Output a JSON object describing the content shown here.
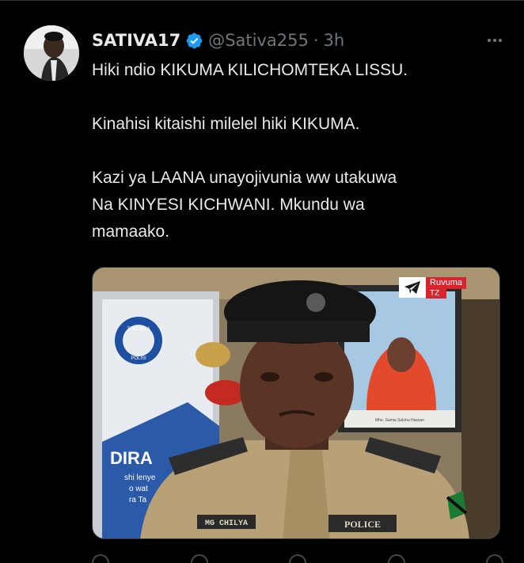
{
  "tweet": {
    "display_name": "SATIVA17",
    "verified": true,
    "handle": "@Sativa255",
    "separator": "·",
    "time": "3h",
    "lines": [
      "Hiki ndio KIKUMA KILICHOMTEKA LISSU.",
      "Kinahisi kitaishi milelel hiki KIKUMA.",
      "Kazi ya LAANA unayojivunia  ww utakuwa",
      "Na KINYESI KICHWANI. Mkundu wa",
      "mamaako."
    ]
  },
  "media": {
    "watermark_line1": "Ruvuma",
    "watermark_line2": "TZ",
    "sign_word": "DIRA",
    "sign_small": [
      "shi lenye",
      "o wat",
      "ra Ta"
    ],
    "name_tag": "MG CHILYA",
    "police_tag": "POLICE",
    "emblem_top": "TANZANIA",
    "emblem_bottom": "POLISI",
    "portrait_caption": "Mhe. Samia Suluhu Hassan"
  },
  "colors": {
    "background": "#000000",
    "primary_text": "#e7e9ea",
    "secondary_text": "#71767b",
    "verified_blue": "#1d9bf0",
    "watermark_red": "#d9242b"
  },
  "icons": [
    "verified-badge-icon",
    "more-options-icon",
    "telegram-icon"
  ]
}
